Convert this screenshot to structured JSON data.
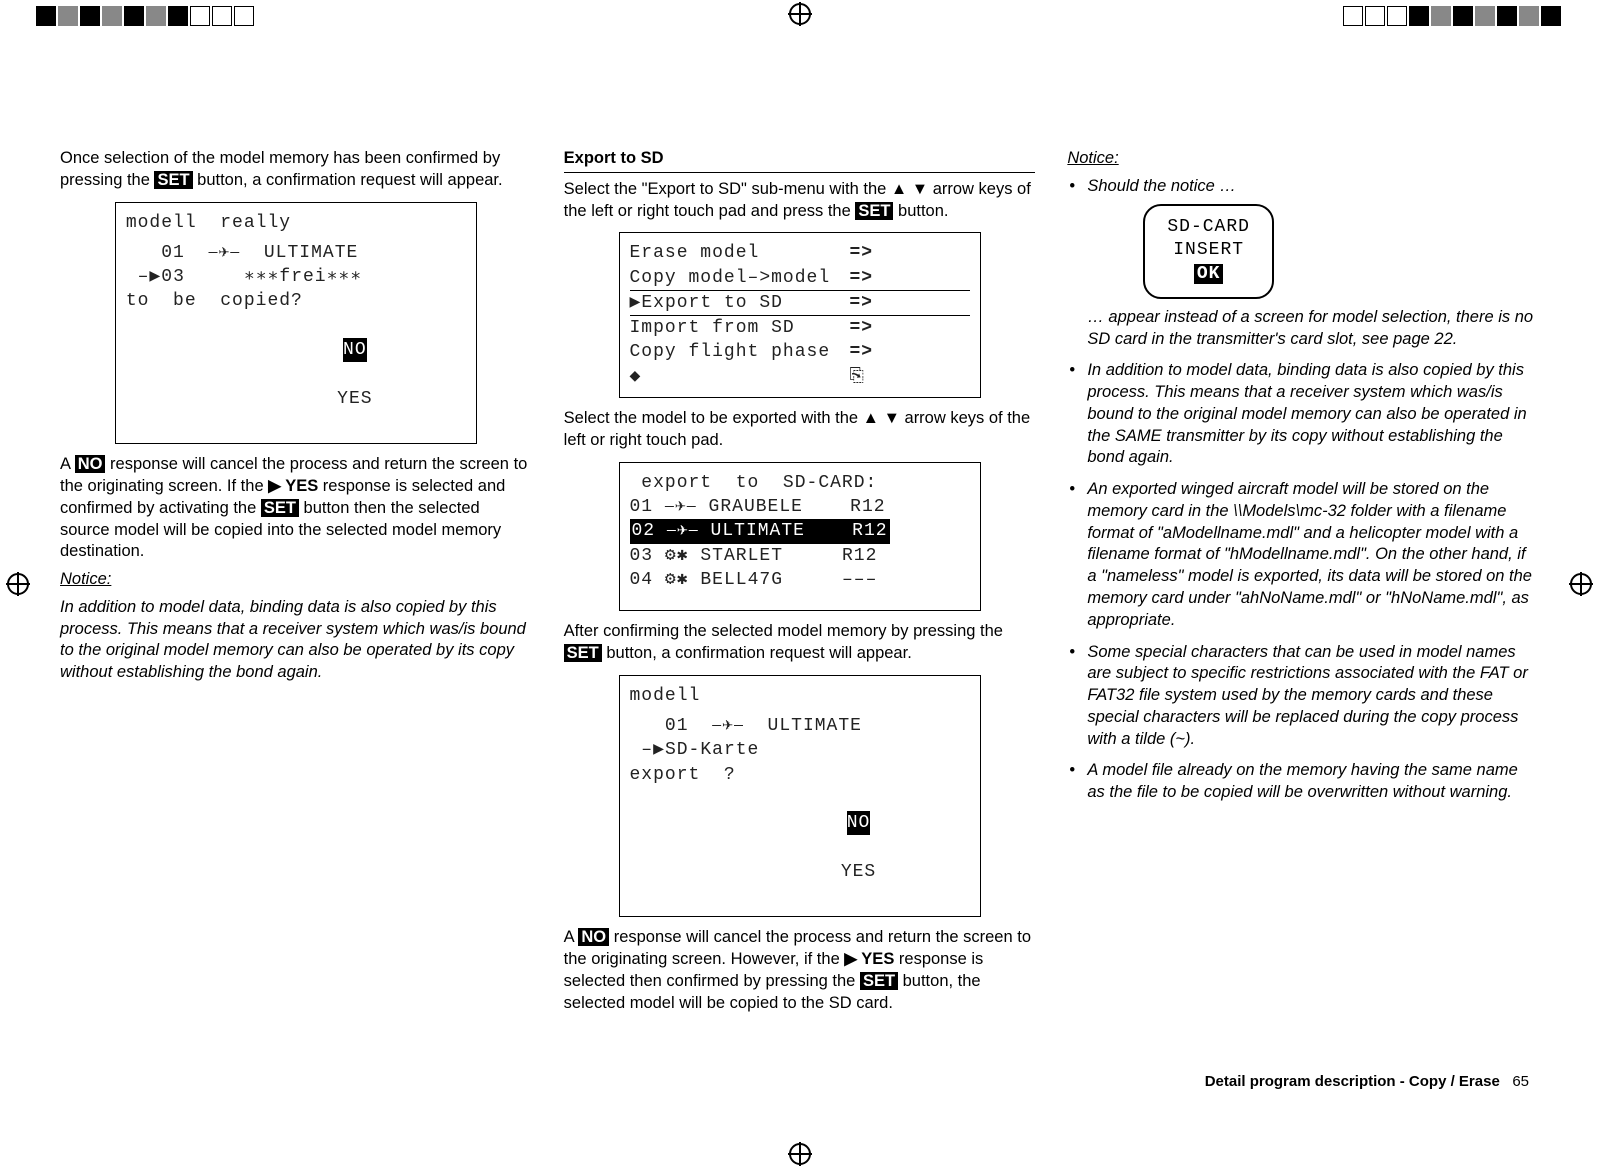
{
  "col1": {
    "p1a": "Once selection of the model memory has been confirmed by pressing the ",
    "p1b": " button, a confirmation request will appear.",
    "lcd1": {
      "l1": "modell  really",
      "l2": "   01  ⎯✈⎯  ULTIMATE",
      "l3": " –▶03     ∗∗∗frei∗∗∗",
      "l4": "to  be  copied?",
      "no": "NO",
      "yes": "YES"
    },
    "p2a": "A ",
    "p2b": " response will cancel the process and return the screen to the originating screen. If the ",
    "p2c": " response is selected and confirmed by activating the ",
    "p2d": " button then the selected source model will be copied into the selected model memory destination.",
    "yeslbl": "▶ YES",
    "noticeLbl": "Notice:",
    "notice": "In addition to model data, binding data is also copied by this process. This means that a receiver system which was/is bound to the original model memory can also be operated by its copy without establishing the bond again."
  },
  "col2": {
    "head": "Export to SD",
    "p1a": "Select the \"Export to SD\" sub-menu with the ▲ ▼ arrow keys of the left or right touch pad and press the ",
    "p1b": " button.",
    "lcd2": {
      "r1a": "Erase model",
      "r1b": "=>",
      "r2a": "Copy model–>model",
      "r2b": "=>",
      "r3a": "Export to SD",
      "r3b": "=>",
      "r4a": "Import from SD",
      "r4b": "=>",
      "r5a": "Copy flight phase",
      "r5b": "=>",
      "r6a": "◆",
      "r6b": "⎘"
    },
    "p2": "Select the model to be exported with the ▲ ▼ arrow keys of the left or right touch pad.",
    "lcd3": {
      "title": " export  to  SD-CARD:",
      "r1": "01 ⎯✈⎯ GRAUBELE    R12",
      "r2": "02 ⎯✈⎯ ULTIMATE    R12",
      "r3": "03 ⚙✱ STARLET     R12",
      "r4": "04 ⚙✱ BELL47G     –––"
    },
    "p3a": "After confirming the selected model memory by pressing the ",
    "p3b": " button, a confirmation request will appear.",
    "lcd4": {
      "l1": "modell",
      "l2": "   01  ⎯✈⎯  ULTIMATE",
      "l3": " –▶SD-Karte",
      "l4": "export  ?",
      "no": "NO",
      "yes": "YES"
    },
    "p4a": "A ",
    "p4b": " response will cancel the process and return the screen to the originating screen. However, if the ",
    "p4c": " response is selected then confirmed by pressing the ",
    "p4d": " button, the selected model will be copied to the SD card.",
    "yeslbl": "▶ YES"
  },
  "col3": {
    "noticeLbl": "Notice:",
    "b1": "Should the notice …",
    "badge": {
      "l1": "SD-CARD",
      "l2": "INSERT",
      "ok": "OK"
    },
    "b1post": "… appear instead of a screen for model selection, there is no SD card in the transmitter's card slot, see page 22.",
    "b2": "In addition to model data, binding data is also copied by this process. This means that a receiver system which was/is bound to the original model memory can also be operated in the SAME transmitter by its copy without establishing the bond again.",
    "b3": "An exported winged aircraft model will be stored on the memory card in the \\\\Models\\mc-32 folder with a filename format of \"aModellname.mdl\" and a helicopter model with a filename format of \"hModellname.mdl\". On the other hand, if a \"nameless\" model is exported, its data will be stored on the memory card under \"ahNoName.mdl\" or \"hNoName.mdl\", as appropriate.",
    "b4": "Some special characters that can be used in model names are subject to specific restrictions associated with the FAT or FAT32 file system used by the memory cards and these special characters will be replaced during the copy process with a tilde (~).",
    "b5": "A model file already on the memory having the same name as the file to be copied will be overwritten without warning."
  },
  "labels": {
    "set": "SET",
    "no": "NO"
  },
  "footer": {
    "title": "Detail program description - Copy / Erase",
    "page": "65"
  }
}
